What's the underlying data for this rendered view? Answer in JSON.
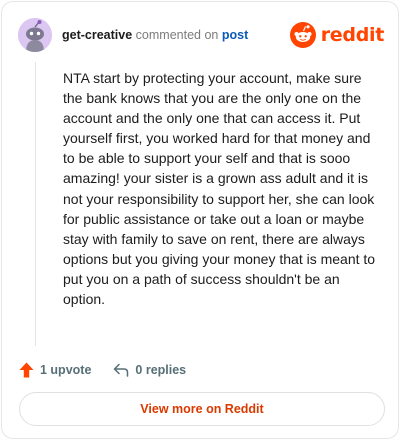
{
  "comment": {
    "author": "get-creative",
    "action_text": "commented on",
    "post_link": "post",
    "body": "NTA start by protecting your account, make sure the bank knows that you are the only one on the account and the only one that can access it. Put yourself first, you worked hard for that money and to be able to support your self and that is sooo amazing! your sister is a grown ass adult and it is not your responsibility to support her, she can look for public assistance or take out a loan or maybe stay with family to save on rent, there are always options but you giving your money that is meant to put you on a path of success shouldn't be an option."
  },
  "brand": {
    "wordmark": "reddit",
    "color": "#ff4500",
    "icon": "reddit-snoo-icon"
  },
  "actions": {
    "upvote_label": "1 upvote",
    "upvote_icon": "upvote-arrow-icon",
    "upvote_color": "#ff4500",
    "replies_label": "0 replies",
    "replies_icon": "reply-arrow-icon"
  },
  "footer": {
    "view_more_label": "View more on Reddit",
    "view_more_color": "#d93a00"
  }
}
